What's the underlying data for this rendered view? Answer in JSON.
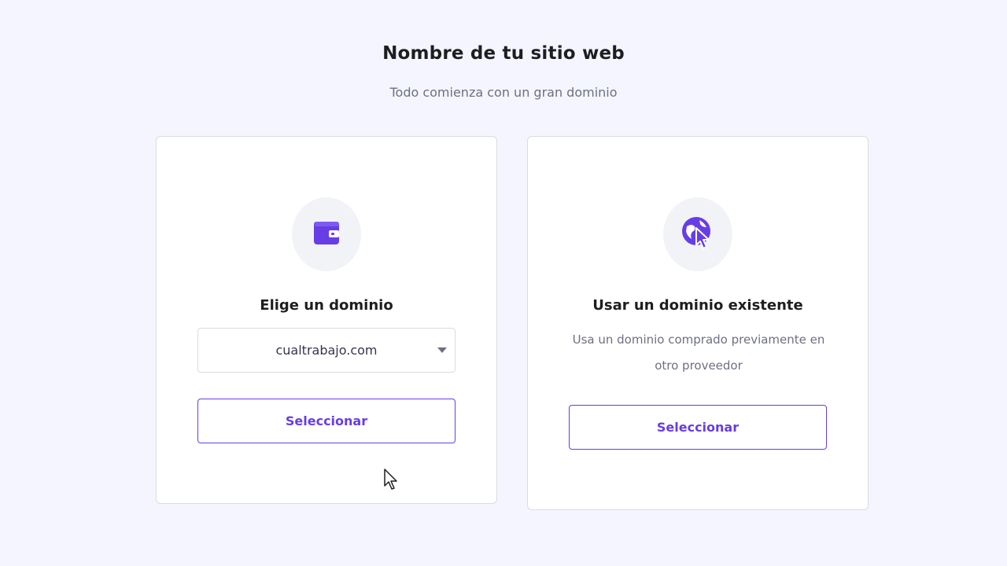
{
  "page": {
    "title": "Nombre de tu sitio web",
    "subtitle": "Todo comienza con un gran dominio"
  },
  "cards": {
    "choose": {
      "icon": "wallet-icon",
      "heading": "Elige un dominio",
      "domain_select": {
        "value": "cualtrabajo.com"
      },
      "button_label": "Seleccionar"
    },
    "existing": {
      "icon": "globe-cursor-icon",
      "heading": "Usar un dominio existente",
      "description": "Usa un dominio comprado previamente en otro proveedor",
      "button_label": "Seleccionar"
    }
  },
  "colors": {
    "accent": "#673de6",
    "background": "#f4f5ff",
    "text_dark": "#1d1e20",
    "text_muted": "#6d7081"
  }
}
